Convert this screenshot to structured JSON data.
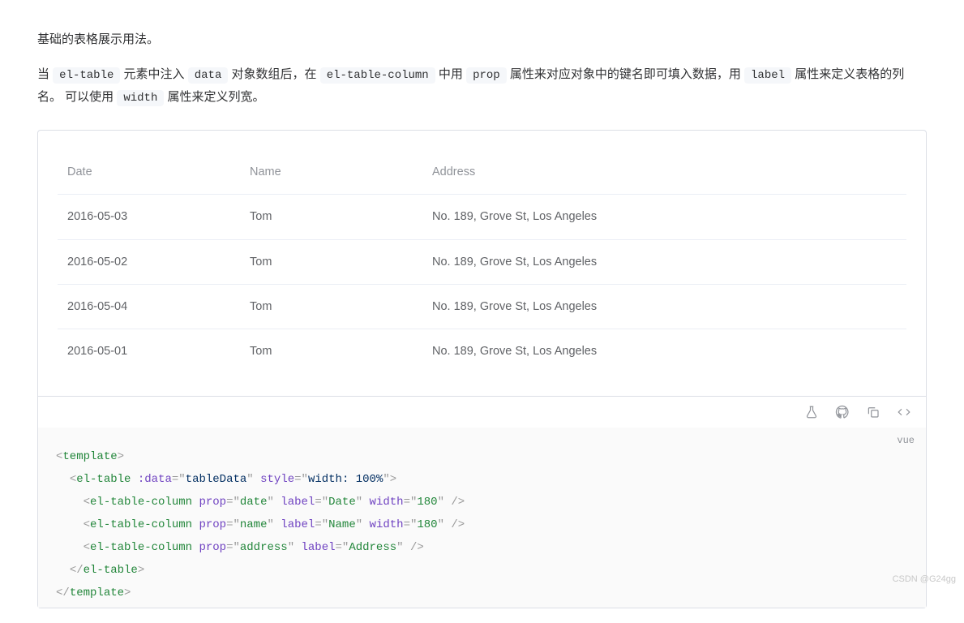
{
  "intro": {
    "line1": "基础的表格展示用法。",
    "line2": {
      "p0": "当 ",
      "c0": "el-table",
      "p1": " 元素中注入 ",
      "c1": "data",
      "p2": " 对象数组后，在 ",
      "c2": "el-table-column",
      "p3": " 中用 ",
      "c3": "prop",
      "p4": " 属性来对应对象中的键名即可填入数据，用 ",
      "c4": "label",
      "p5": " 属性来定义表格的列名。 可以使用 ",
      "c5": "width",
      "p6": " 属性来定义列宽。"
    }
  },
  "table": {
    "headers": {
      "date": "Date",
      "name": "Name",
      "address": "Address"
    },
    "rows": [
      {
        "date": "2016-05-03",
        "name": "Tom",
        "address": "No. 189, Grove St, Los Angeles"
      },
      {
        "date": "2016-05-02",
        "name": "Tom",
        "address": "No. 189, Grove St, Los Angeles"
      },
      {
        "date": "2016-05-04",
        "name": "Tom",
        "address": "No. 189, Grove St, Los Angeles"
      },
      {
        "date": "2016-05-01",
        "name": "Tom",
        "address": "No. 189, Grove St, Los Angeles"
      }
    ]
  },
  "code_lang": "vue",
  "code": {
    "tag_template": "template",
    "tag_eltable": "el-table",
    "tag_eltcol": "el-table-column",
    "attr_data": ":data",
    "val_data": "tableData",
    "attr_style": "style",
    "val_style": "width: 100%",
    "attr_prop": "prop",
    "attr_label": "label",
    "attr_width": "width",
    "c1_prop": "date",
    "c1_label": "Date",
    "c1_width": "180",
    "c2_prop": "name",
    "c2_label": "Name",
    "c2_width": "180",
    "c3_prop": "address",
    "c3_label": "Address"
  },
  "watermark": "CSDN @G24gg"
}
